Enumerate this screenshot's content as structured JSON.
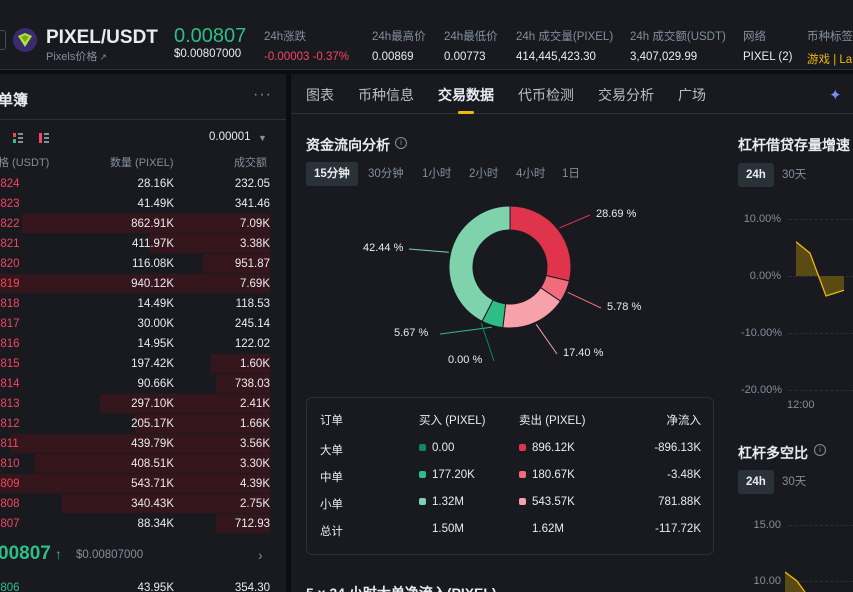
{
  "header": {
    "pair": "PIXEL/USDT",
    "sub": "Pixels价格",
    "sub_arrow": "↗",
    "price": "0.00807",
    "price_usd": "$0.00807000",
    "stats": [
      {
        "label": "24h涨跌",
        "value": "-0.00003 -0.37%",
        "color": "#f6465d"
      },
      {
        "label": "24h最高价",
        "value": "0.00869",
        "color": "#eaecef"
      },
      {
        "label": "24h最低价",
        "value": "0.00773",
        "color": "#eaecef"
      },
      {
        "label": "24h 成交量(PIXEL)",
        "value": "414,445,423.30",
        "color": "#eaecef"
      },
      {
        "label": "24h 成交额(USDT)",
        "value": "3,407,029.99",
        "color": "#eaecef"
      },
      {
        "label": "网络",
        "value": "PIXEL (2)",
        "color": "#eaecef"
      },
      {
        "label": "币种标签",
        "value": "游戏 | La",
        "color": "#f0b90b"
      }
    ]
  },
  "orderbook": {
    "title": "单簿",
    "more": "···",
    "precision": "0.00001",
    "col_price": "格 (USDT)",
    "col_qty": "数量 (PIXEL)",
    "col_total": "成交额",
    "asks": [
      {
        "p": "0824",
        "q": "28.16K",
        "t": "232.05",
        "d": 0.0
      },
      {
        "p": "0823",
        "q": "41.49K",
        "t": "341.46",
        "d": 0.0
      },
      {
        "p": "0822",
        "q": "862.91K",
        "t": "7.09K",
        "d": 0.92
      },
      {
        "p": "0821",
        "q": "411.97K",
        "t": "3.38K",
        "d": 0.45
      },
      {
        "p": "0820",
        "q": "116.08K",
        "t": "951.87",
        "d": 0.25
      },
      {
        "p": "0819",
        "q": "940.12K",
        "t": "7.69K",
        "d": 1.0
      },
      {
        "p": "0818",
        "q": "14.49K",
        "t": "118.53",
        "d": 0.0
      },
      {
        "p": "0817",
        "q": "30.00K",
        "t": "245.14",
        "d": 0.0
      },
      {
        "p": "0816",
        "q": "14.95K",
        "t": "122.02",
        "d": 0.0
      },
      {
        "p": "0815",
        "q": "197.42K",
        "t": "1.60K",
        "d": 0.22
      },
      {
        "p": "0814",
        "q": "90.66K",
        "t": "738.03",
        "d": 0.2
      },
      {
        "p": "0813",
        "q": "297.10K",
        "t": "2.41K",
        "d": 0.63
      },
      {
        "p": "0812",
        "q": "205.17K",
        "t": "1.66K",
        "d": 0.5
      },
      {
        "p": "0811",
        "q": "439.79K",
        "t": "3.56K",
        "d": 0.96
      },
      {
        "p": "0810",
        "q": "408.51K",
        "t": "3.30K",
        "d": 0.87
      },
      {
        "p": "0809",
        "q": "543.71K",
        "t": "4.39K",
        "d": 1.0
      },
      {
        "p": "0808",
        "q": "340.43K",
        "t": "2.75K",
        "d": 0.77
      },
      {
        "p": "0807",
        "q": "88.34K",
        "t": "712.93",
        "d": 0.2
      }
    ],
    "mid_price": "00807",
    "mid_arrow": "↑",
    "mid_usd": "$0.00807000",
    "mid_chev": "›",
    "bid": {
      "p": "0806",
      "q": "43.95K",
      "t": "354.30"
    }
  },
  "tabs": [
    {
      "label": "图表",
      "active": false
    },
    {
      "label": "币种信息",
      "active": false
    },
    {
      "label": "交易数据",
      "active": true
    },
    {
      "label": "代币检测",
      "active": false
    },
    {
      "label": "交易分析",
      "active": false
    },
    {
      "label": "广场",
      "active": false
    }
  ],
  "fund_flow": {
    "title": "资金流向分析",
    "timeframes": [
      {
        "label": "15分钟",
        "active": true
      },
      {
        "label": "30分钟",
        "active": false
      },
      {
        "label": "1小时",
        "active": false
      },
      {
        "label": "2小时",
        "active": false
      },
      {
        "label": "4小时",
        "active": false
      },
      {
        "label": "1日",
        "active": false
      }
    ],
    "slices": [
      {
        "label": "28.69 %",
        "value": 28.69,
        "color": "#e0344d"
      },
      {
        "label": "5.78 %",
        "value": 5.78,
        "color": "#f26b7c"
      },
      {
        "label": "17.40 %",
        "value": 17.4,
        "color": "#f7a1aa"
      },
      {
        "label": "5.67 %",
        "value": 5.67,
        "color": "#2ebd85"
      },
      {
        "label": "0.00 %",
        "value": 0.0,
        "color": "#0c8a5c"
      },
      {
        "label": "42.44 %",
        "value": 42.44,
        "color": "#7fd3ac"
      }
    ],
    "table": {
      "headers": [
        "订单",
        "买入 (PIXEL)",
        "卖出 (PIXEL)",
        "净流入"
      ],
      "rows": [
        {
          "name": "大单",
          "buy": "0.00",
          "buy_color": "#0c8a5c",
          "sell": "896.12K",
          "sell_color": "#e0344d",
          "net": "-896.13K"
        },
        {
          "name": "中单",
          "buy": "177.20K",
          "buy_color": "#2ebd85",
          "sell": "180.67K",
          "sell_color": "#f26b7c",
          "net": "-3.48K"
        },
        {
          "name": "小单",
          "buy": "1.32M",
          "buy_color": "#7fd3ac",
          "sell": "543.57K",
          "sell_color": "#f7a1aa",
          "net": "781.88K"
        },
        {
          "name": "总计",
          "buy": "1.50M",
          "buy_color": "",
          "sell": "1.62M",
          "sell_color": "",
          "net": "-117.72K"
        }
      ]
    },
    "bottom_title": "5 x 24 小时大单净流入(PIXEL)"
  },
  "margin_growth": {
    "title": "杠杆借贷存量增速",
    "tabs": [
      "24h",
      "30天"
    ],
    "yticks": [
      "10.00%",
      "0.00%",
      "-10.00%",
      "-20.00%"
    ],
    "xtick": "12:00",
    "points": [
      6,
      4,
      -3.5,
      -2.5
    ]
  },
  "long_short": {
    "title": "杠杆多空比",
    "tabs": [
      "24h",
      "30天"
    ],
    "yticks": [
      "15.00",
      "10.00"
    ]
  }
}
